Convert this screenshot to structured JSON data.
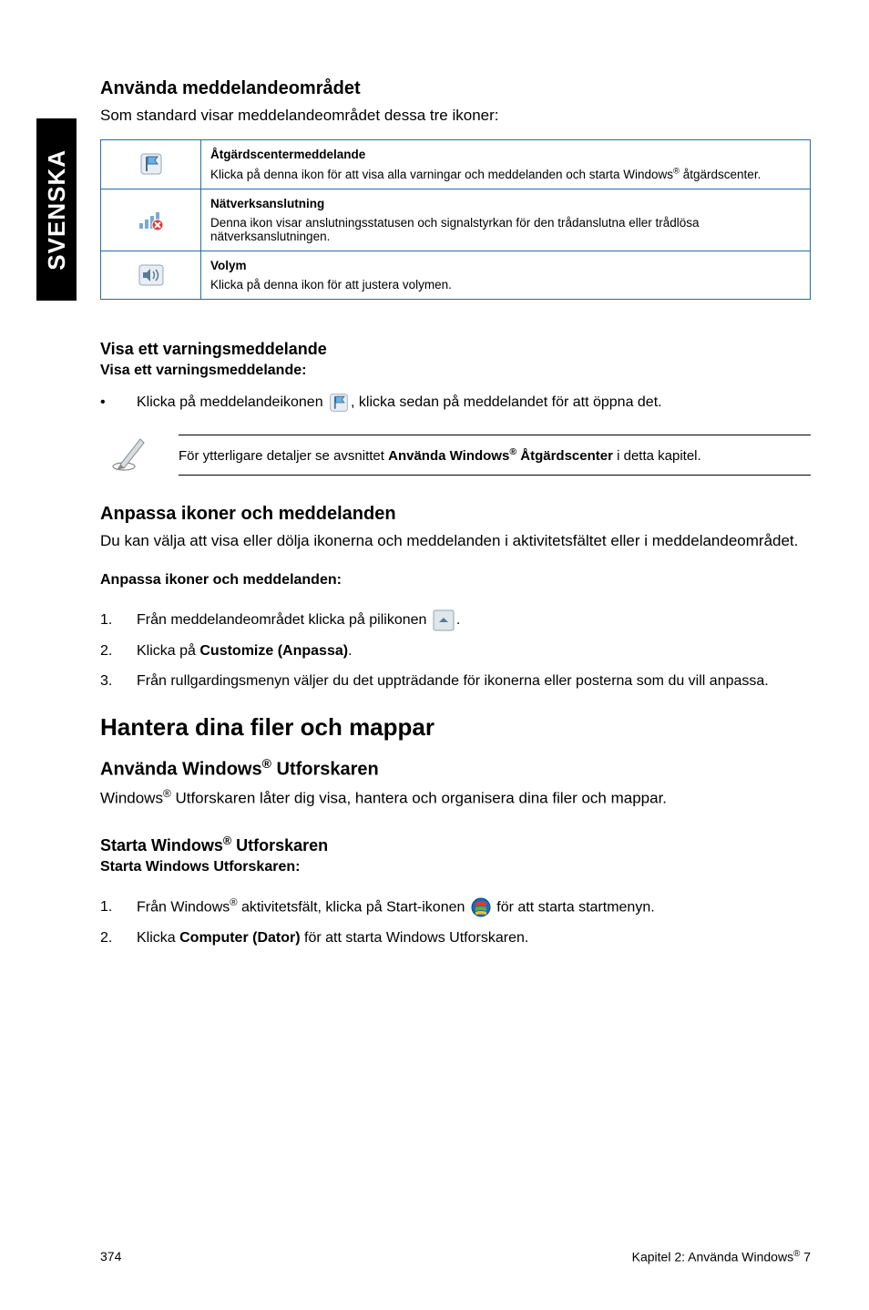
{
  "sidebar": {
    "label": "SVENSKA"
  },
  "s1": {
    "heading": "Använda meddelandeområdet",
    "intro": "Som standard visar meddelandeområdet dessa tre ikoner:",
    "rows": [
      {
        "title": "Åtgärdscentermeddelande",
        "desc_pre": "Klicka på denna ikon för att visa alla varningar och meddelanden och starta Windows",
        "desc_post": " åtgärdscenter."
      },
      {
        "title": "Nätverksanslutning",
        "desc": "Denna ikon visar anslutningsstatusen och signalstyrkan för den trådanslutna eller trådlösa nätverksanslutningen."
      },
      {
        "title": "Volym",
        "desc": "Klicka på denna ikon för att justera volymen."
      }
    ]
  },
  "s2": {
    "heading": "Visa ett varningsmeddelande",
    "subheading": "Visa ett varningsmeddelande:",
    "bullet_pre": "Klicka på meddelandeikonen ",
    "bullet_post": ", klicka sedan på meddelandet för att öppna det."
  },
  "note": {
    "pre": "För ytterligare detaljer se avsnittet ",
    "bold1": "Använda Windows",
    "bold2": " Åtgärdscenter",
    "post": " i detta kapitel."
  },
  "s3": {
    "heading": "Anpassa ikoner och meddelanden",
    "intro": "Du kan välja att visa eller dölja ikonerna och meddelanden i aktivitetsfältet eller i meddelandeområdet.",
    "subheading": "Anpassa ikoner och meddelanden:",
    "steps": {
      "s1_pre": "Från meddelandeområdet klicka på pilikonen ",
      "s1_post": ".",
      "s2_pre": "Klicka på ",
      "s2_bold": "Customize (Anpassa)",
      "s2_post": ".",
      "s3": "Från rullgardingsmenyn väljer du det uppträdande för ikonerna eller posterna som du vill anpassa."
    }
  },
  "s4": {
    "bigheading": "Hantera dina filer och mappar",
    "sub1_pre": "Använda Windows",
    "sub1_post": " Utforskaren",
    "intro_pre": "Windows",
    "intro_post": " Utforskaren låter dig visa, hantera och organisera dina filer och mappar.",
    "sub2_pre": "Starta Windows",
    "sub2_post": " Utforskaren",
    "sub3": "Starta Windows Utforskaren:",
    "steps": {
      "s1_pre": "Från Windows",
      "s1_mid": " aktivitetsfält, klicka på Start-ikonen ",
      "s1_post": " för att starta startmenyn.",
      "s2_pre": "Klicka ",
      "s2_bold": "Computer (Dator)",
      "s2_post": " för att starta Windows Utforskaren."
    }
  },
  "footer": {
    "page": "374",
    "chapter_pre": "Kapitel 2: Använda Windows",
    "chapter_post": " 7"
  },
  "nums": {
    "n1": "1.",
    "n2": "2.",
    "n3": "3."
  },
  "bullet": "•"
}
